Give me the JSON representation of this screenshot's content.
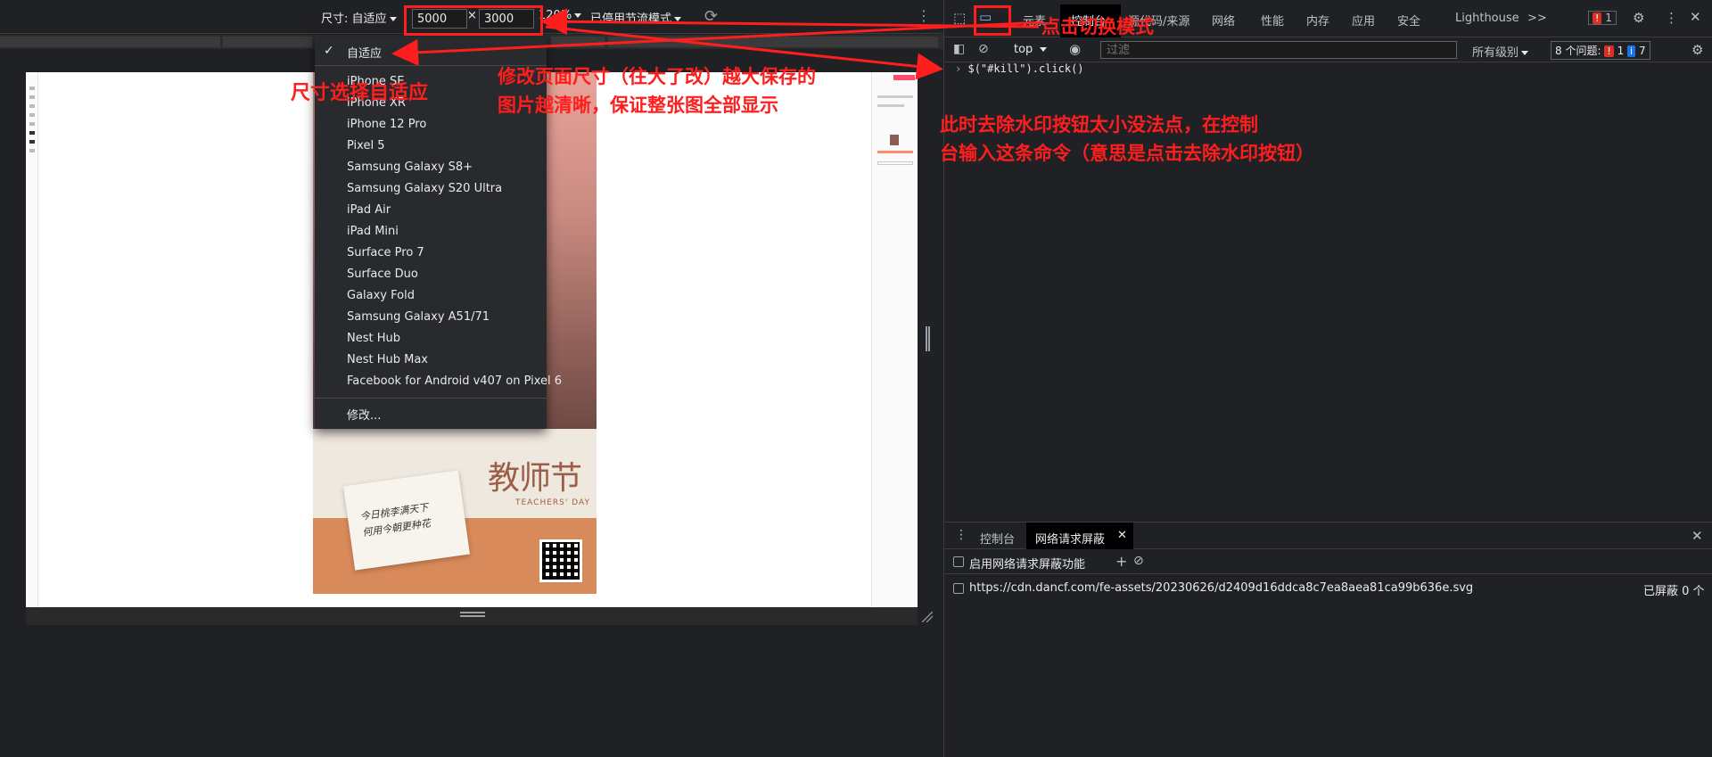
{
  "device_toolbar": {
    "dimensions_label": "尺寸: 自适应",
    "width_value": "5000",
    "times": "×",
    "height_value": "3000",
    "zoom_label": "120%",
    "throttle_label": "已停用节流模式",
    "rotate_icon": "rotate-icon",
    "more_icon": "more-vert-icon"
  },
  "dropdown": {
    "selected": "自适应",
    "devices": [
      "iPhone SE",
      "iPhone XR",
      "iPhone 12 Pro",
      "Pixel 5",
      "Samsung Galaxy S8+",
      "Samsung Galaxy S20 Ultra",
      "iPad Air",
      "iPad Mini",
      "Surface Pro 7",
      "Surface Duo",
      "Galaxy Fold",
      "Samsung Galaxy A51/71",
      "Nest Hub",
      "Nest Hub Max",
      "Facebook for Android v407 on Pixel 6"
    ],
    "edit_label": "修改..."
  },
  "poster": {
    "title": "教师节",
    "subtitle": "TEACHERS' DAY",
    "card_text": "今日桃李满天下\n何用今朝更种花"
  },
  "devtools": {
    "tabs": [
      "元素",
      "控制台",
      "源代码/来源",
      "网络",
      "性能",
      "内存",
      "应用",
      "安全",
      "Lighthouse"
    ],
    "more_tabs": ">>",
    "error_badge": "1",
    "context": "top",
    "filter_placeholder": "过滤",
    "levels": "所有级别",
    "issues_label": "8 个问题:",
    "issues_red": "1",
    "issues_blue": "7",
    "console_command": "$(\"#kill\").click()",
    "drawer_tabs": [
      "控制台",
      "网络请求屏蔽"
    ],
    "enable_blocking": "启用网络请求屏蔽功能",
    "blocked_url": "https://cdn.dancf.com/fe-assets/20230626/d2409d16ddca8c7ea8aea81ca99b636e.svg",
    "blocked_count": "已屏蔽 0 个"
  },
  "annotations": {
    "toggle_mode": "点击切换模式",
    "choose_responsive": "尺寸选择自适应",
    "change_size_line1": "修改页面尺寸（往大了改）越大保存的",
    "change_size_line2": "图片越清晰，保证整张图全部显示",
    "console_tip_line1": "此时去除水印按钮太小没法点，在控制",
    "console_tip_line2": "台输入这条命令（意思是点击去除水印按钮）"
  },
  "colors": {
    "annotation": "#ff1e1e",
    "devtools_bg": "#202124",
    "menu_bg": "#292a2d",
    "issue_red": "#d93025",
    "issue_blue": "#1a73e8"
  }
}
